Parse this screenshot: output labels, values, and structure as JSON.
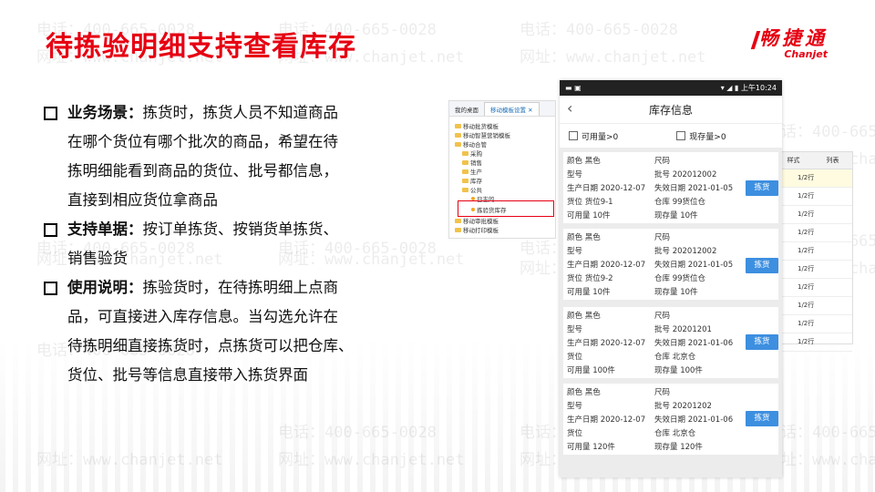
{
  "slide": {
    "title": "待拣验明细支持查看库存",
    "watermark_phone": "电话：400-665-0028",
    "watermark_site": "网址：www.chanjet.net",
    "accent_color": "#e60012"
  },
  "logo": {
    "cn": "畅捷通",
    "en": "Chanjet"
  },
  "bullets": [
    {
      "head": "业务场景：",
      "lines": [
        "拣货时，拣货人员不知道商品",
        "在哪个货位有哪个批次的商品，希望在待",
        "拣明细能看到商品的货位、批号都信息，",
        "直接到相应货位拿商品"
      ]
    },
    {
      "head": "支持单据：",
      "lines": [
        "按订单拣货、按销货单拣货、",
        "销售验货"
      ]
    },
    {
      "head": "使用说明：",
      "lines": [
        "拣验货时，在待拣明细上点商",
        "品，可直接进入库存信息。当勾选允许在",
        "待拣明细直接拣货时，点拣货可以把仓库、",
        "货位、批号等信息直接带入拣货界面"
      ]
    }
  ],
  "desktop": {
    "tabs": [
      "我的桌面",
      "移动模板设置"
    ],
    "close_icon": "close-icon",
    "tree": [
      "移动批货模板",
      "移动智慧营销模板",
      "移动合管",
      "采购",
      "销售",
      "生产",
      "库存",
      "公共",
      "日志的",
      "拣验货库存",
      "移动审批模板",
      "移动打印模板"
    ]
  },
  "table": {
    "headers": [
      "样式",
      "列表"
    ],
    "rows": [
      "1/2行",
      "1/2行",
      "1/2行",
      "1/2行",
      "1/2行",
      "1/2行",
      "1/2行",
      "1/2行",
      "1/2行",
      "1/2行"
    ]
  },
  "phone": {
    "status_time": "上午10:24",
    "title": "库存信息",
    "filters": [
      "可用量>0",
      "现存量>0"
    ],
    "pick_label": "拣货",
    "cards": [
      {
        "c1": [
          "颜色 黑色",
          "型号",
          "生产日期 2020-12-07",
          "货位 货位9-1",
          "可用量 10件"
        ],
        "c2": [
          "尺码",
          "批号 202012002",
          "失效日期 2021-01-05",
          "仓库 99货位仓",
          "现存量 10件"
        ]
      },
      {
        "c1": [
          "颜色 黑色",
          "型号",
          "生产日期 2020-12-07",
          "货位 货位9-2",
          "可用量 10件"
        ],
        "c2": [
          "尺码",
          "批号 202012002",
          "失效日期 2021-01-05",
          "仓库 99货位仓",
          "现存量 10件"
        ]
      },
      {
        "c1": [
          "颜色 黑色",
          "型号",
          "生产日期 2020-12-07",
          "货位",
          "可用量 100件"
        ],
        "c2": [
          "尺码",
          "批号 20201201",
          "失效日期 2021-01-06",
          "仓库 北京仓",
          "现存量 100件"
        ]
      },
      {
        "c1": [
          "颜色 黑色",
          "型号",
          "生产日期 2020-12-07",
          "货位",
          "可用量 120件"
        ],
        "c2": [
          "尺码",
          "批号 20201202",
          "失效日期 2021-01-06",
          "仓库 北京仓",
          "现存量 120件"
        ]
      }
    ]
  }
}
